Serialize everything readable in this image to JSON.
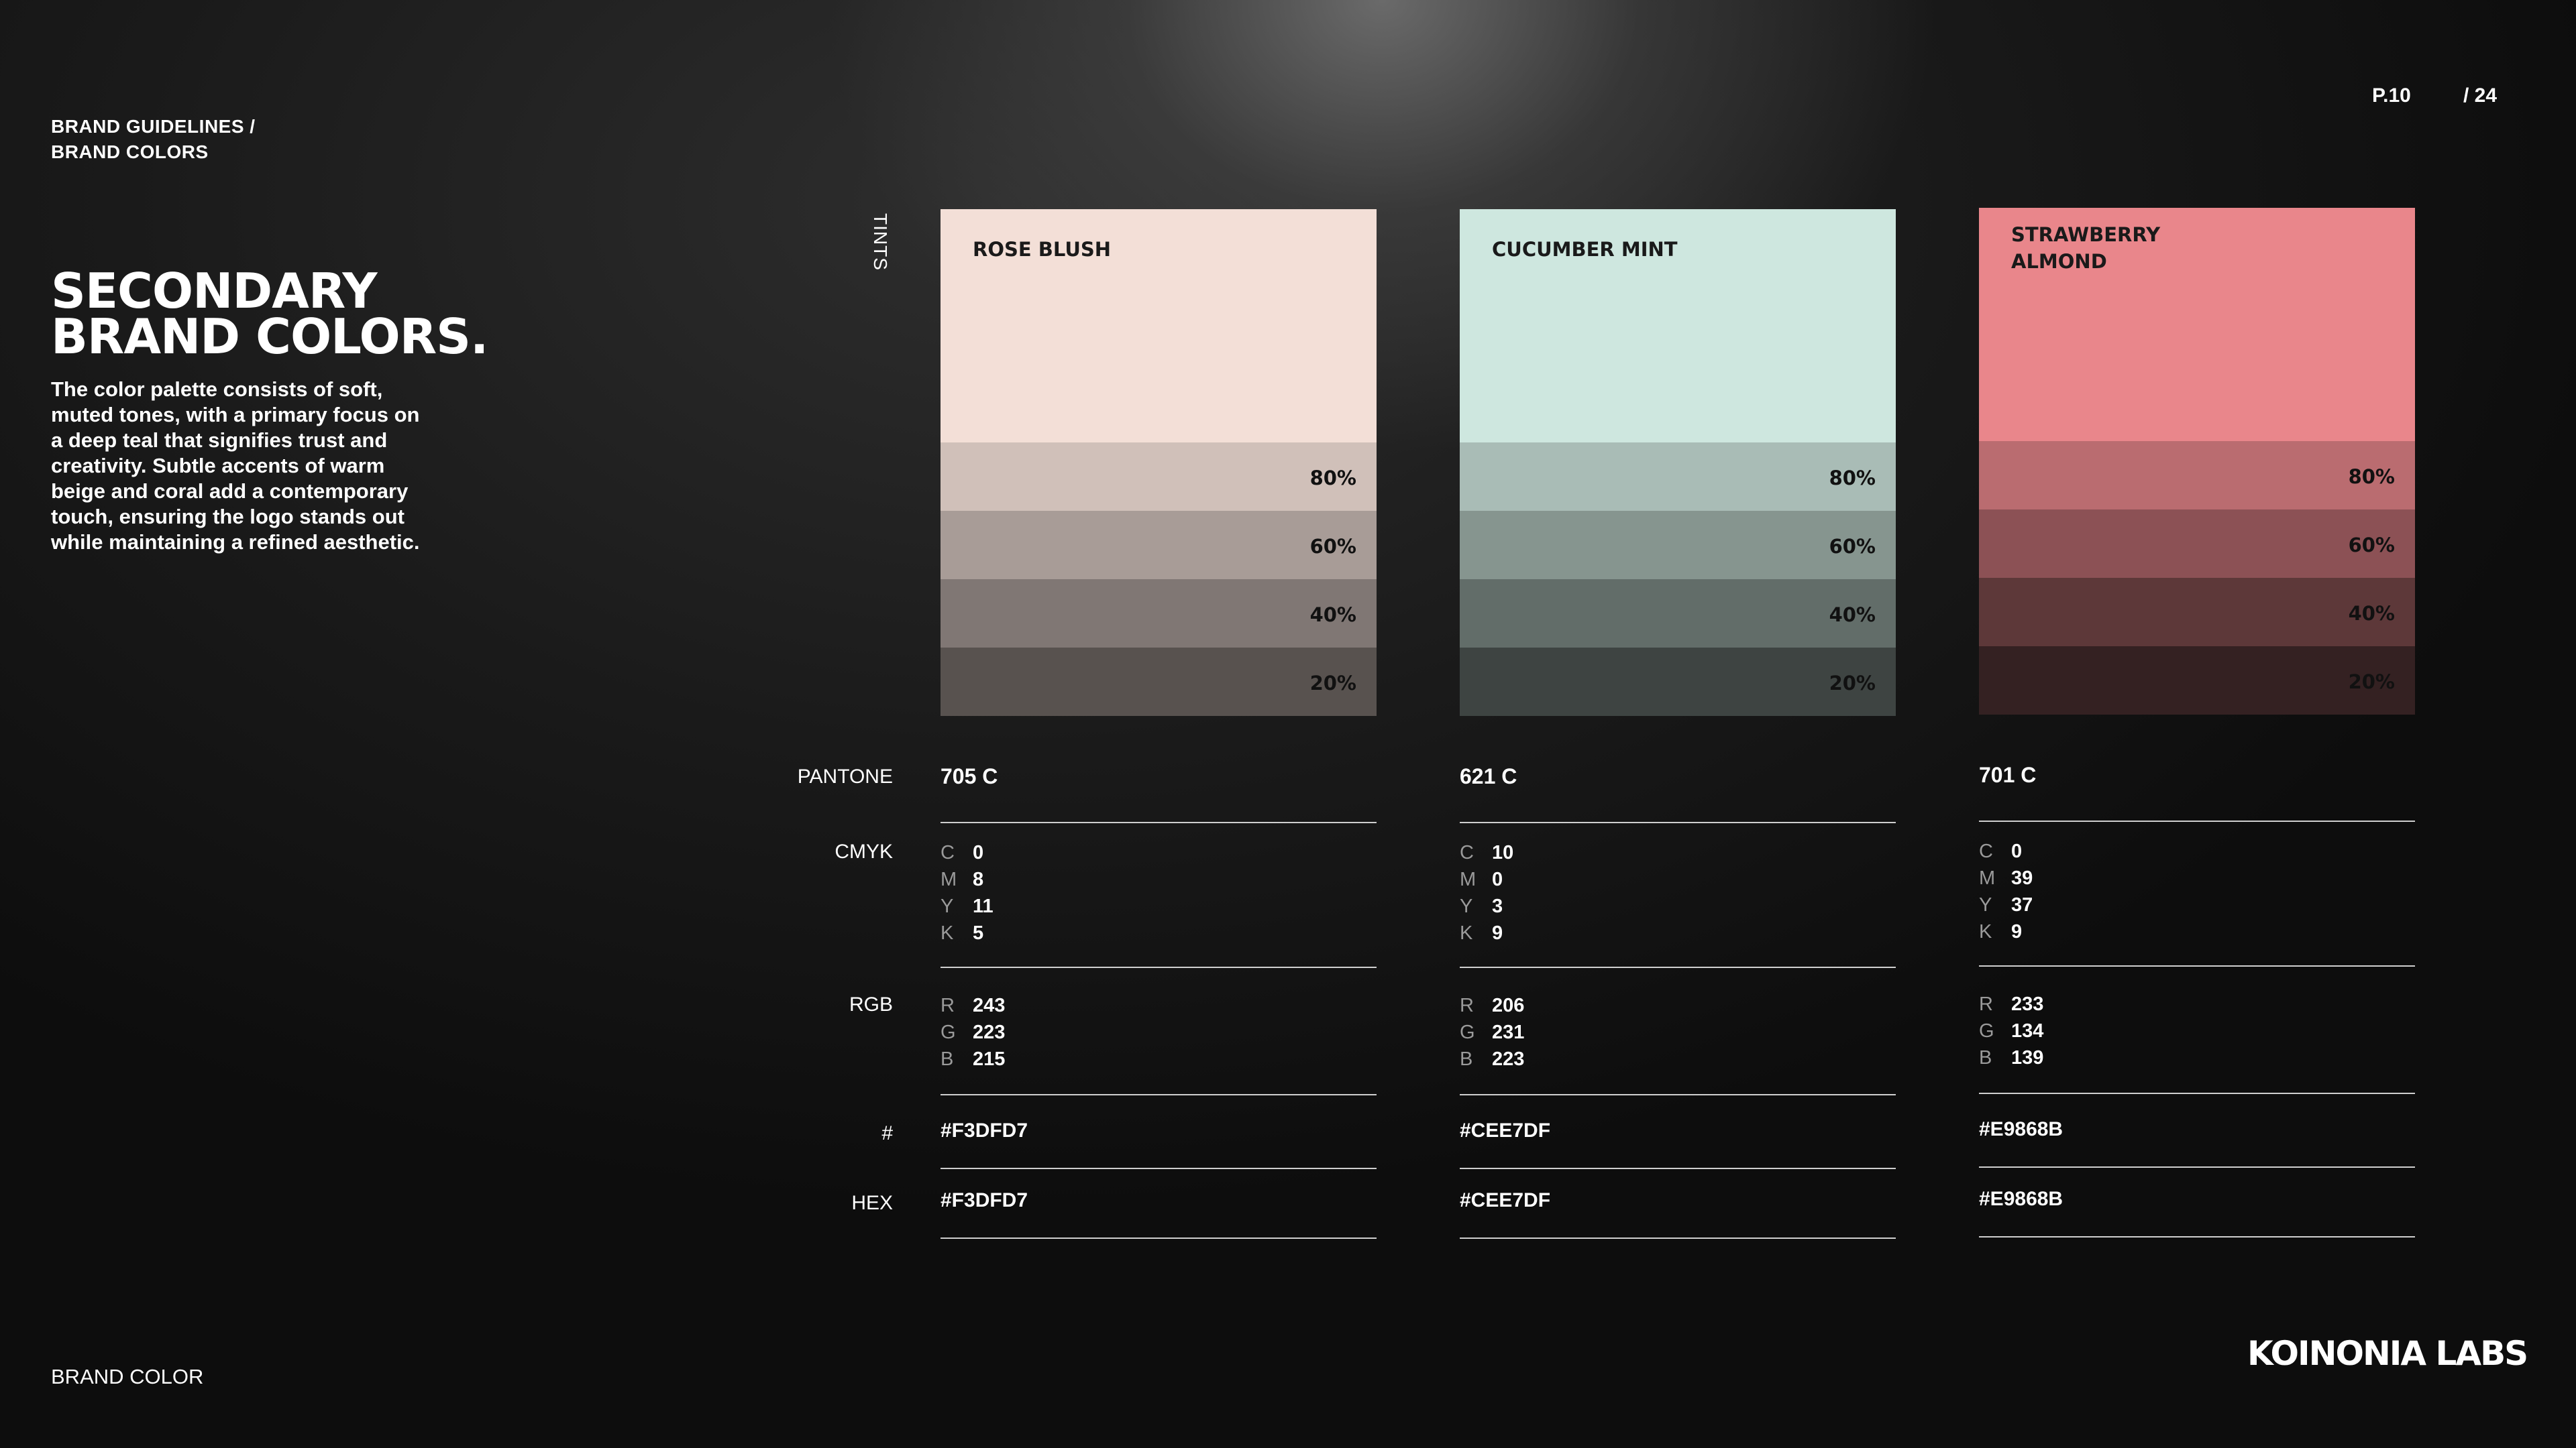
{
  "breadcrumb": {
    "line1": "BRAND GUIDELINES  /",
    "line2": "BRAND COLORS"
  },
  "pager": {
    "current": "P.10",
    "total": "/ 24"
  },
  "heading": {
    "line1": "SECONDARY",
    "line2": "BRAND COLORS."
  },
  "description": "The color palette consists of soft, muted tones, with a primary focus on a deep teal that signifies trust and creativity. Subtle accents of warm beige and coral add a contemporary touch, ensuring the logo stands out while maintaining a refined aesthetic.",
  "labels": {
    "tints": "TINTS",
    "pantone": "PANTONE",
    "cmyk": "CMYK",
    "rgb": "RGB",
    "hash": "#",
    "hex": "HEX"
  },
  "tint_levels": [
    "80%",
    "60%",
    "40%",
    "20%"
  ],
  "colors": [
    {
      "name_line1": "ROSE BLUSH",
      "name_line2": "",
      "swatch": "#F3DFD7",
      "tints": [
        "#D0C0B9",
        "#A89C97",
        "#807774",
        "#58524F"
      ],
      "pantone": "705 C",
      "cmyk": {
        "c": "0",
        "m": "8",
        "y": "11",
        "k": "5"
      },
      "rgb": {
        "r": "243",
        "g": "223",
        "b": "215"
      },
      "hash": "#F3DFD7",
      "hex": "#F3DFD7"
    },
    {
      "name_line1": "CUCUMBER MINT",
      "name_line2": "",
      "swatch": "#CEE7DF",
      "tints": [
        "#A9BCB6",
        "#86958F",
        "#626D69",
        "#3E4442"
      ],
      "pantone": "621 C",
      "cmyk": {
        "c": "10",
        "m": "0",
        "y": "3",
        "k": "9"
      },
      "rgb": {
        "r": "206",
        "g": "231",
        "b": "223"
      },
      "hash": "#CEE7DF",
      "hex": "#CEE7DF"
    },
    {
      "name_line1": "STRAWBERRY",
      "name_line2": "ALMOND",
      "swatch": "#E9868B",
      "tints": [
        "#BA6C70",
        "#8C5155",
        "#5D3839",
        "#342122"
      ],
      "pantone": "701 C",
      "cmyk": {
        "c": "0",
        "m": "39",
        "y": "37",
        "k": "9"
      },
      "rgb": {
        "r": "233",
        "g": "134",
        "b": "139"
      },
      "hash": "#E9868B",
      "hex": "#E9868B"
    }
  ],
  "footer": {
    "section": "BRAND COLOR",
    "logo": "KOINONIA LABS"
  }
}
